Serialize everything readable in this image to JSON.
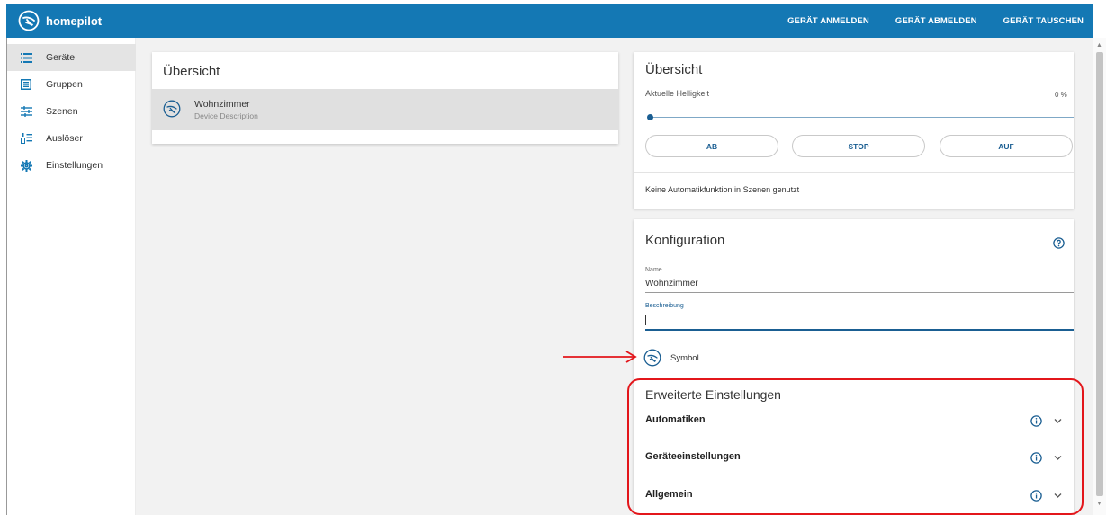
{
  "app": {
    "brand": "homepilot",
    "logo_icon": "homepilot-logo-icon",
    "accent_color": "#1478b4",
    "primary_dark": "#1a5e92",
    "highlight_color": "#e3161b"
  },
  "topnav": {
    "items": [
      "GERÄT ANMELDEN",
      "GERÄT ABMELDEN",
      "GERÄT TAUSCHEN"
    ]
  },
  "sidebar": {
    "active_index": 0,
    "items": [
      {
        "label": "Geräte",
        "icon": "device-list-icon"
      },
      {
        "label": "Gruppen",
        "icon": "groups-icon"
      },
      {
        "label": "Szenen",
        "icon": "scenes-icon"
      },
      {
        "label": "Auslöser",
        "icon": "trigger-icon"
      },
      {
        "label": "Einstellungen",
        "icon": "gear-icon"
      }
    ]
  },
  "device_list": {
    "title": "Übersicht",
    "devices": [
      {
        "name": "Wohnzimmer",
        "description": "Device Description",
        "icon": "shutter-device-icon",
        "selected": true
      }
    ]
  },
  "detail_overview": {
    "title": "Übersicht",
    "brightness_label": "Aktuelle Helligkeit",
    "brightness_value": "0 %",
    "brightness_fraction": 0,
    "buttons": [
      "AB",
      "STOP",
      "AUF"
    ],
    "automation_note": "Keine Automatikfunktion in Szenen genutzt"
  },
  "configuration": {
    "title": "Konfiguration",
    "help_icon": "help-circle-icon",
    "name_label": "Name",
    "name_value": "Wohnzimmer",
    "description_label": "Beschreibung",
    "description_value": "",
    "symbol_label": "Symbol",
    "symbol_icon": "shutter-device-icon"
  },
  "advanced": {
    "title": "Erweiterte Einstellungen",
    "sections": [
      {
        "label": "Automatiken",
        "info_icon": "info-icon",
        "chevron": "chevron-down-icon"
      },
      {
        "label": "Geräteeinstellungen",
        "info_icon": "info-icon",
        "chevron": "chevron-down-icon"
      },
      {
        "label": "Allgemein",
        "info_icon": "info-icon",
        "chevron": "chevron-down-icon"
      }
    ]
  },
  "annotations": {
    "arrow": "red-arrow-icon",
    "highlight": "red-highlight-frame"
  }
}
